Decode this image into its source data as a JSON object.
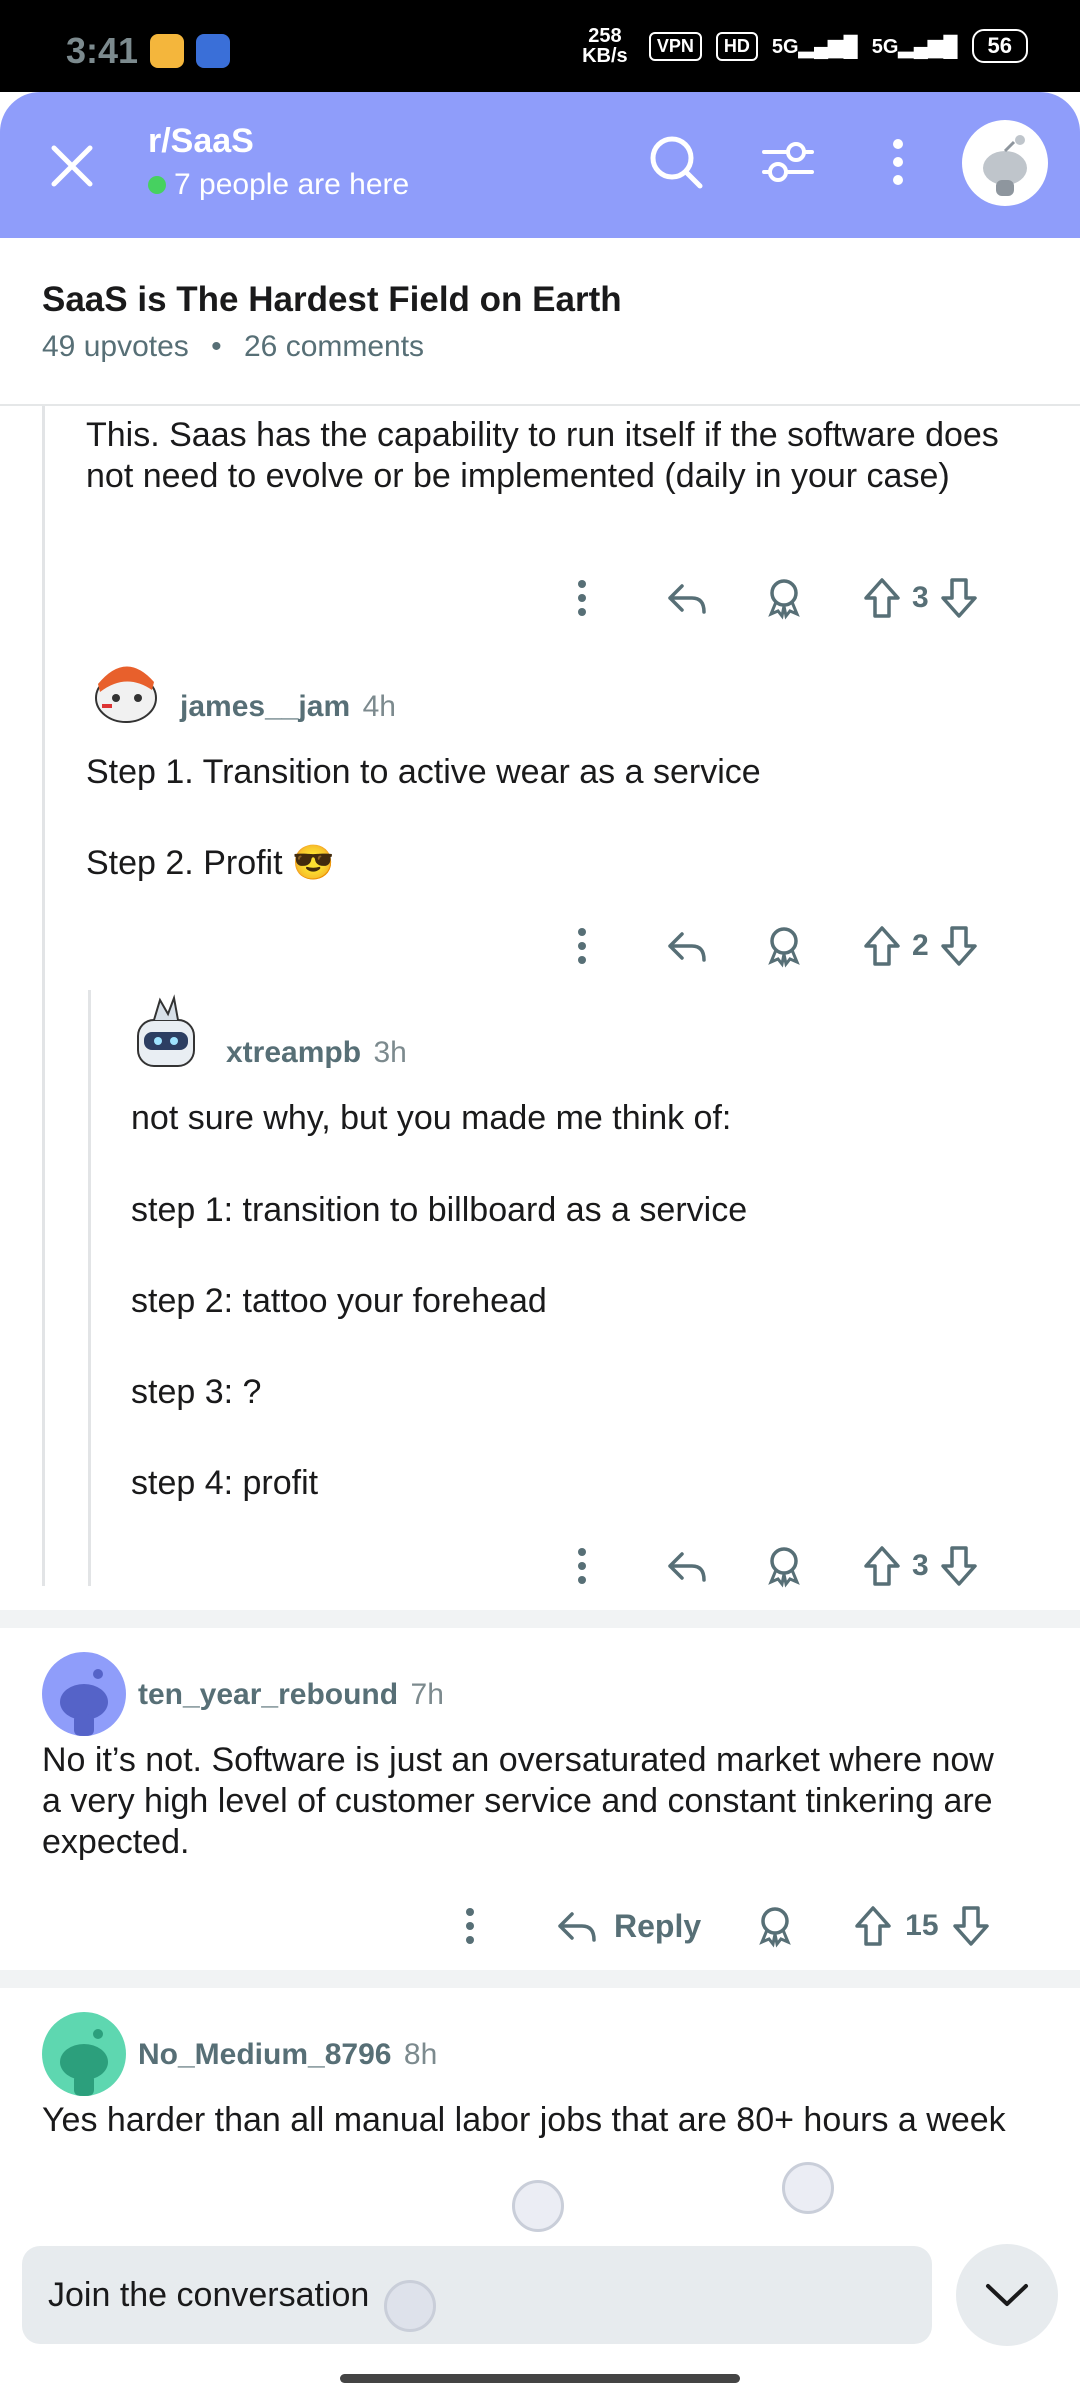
{
  "status_bar": {
    "time": "3:41",
    "speed": "258 KB/s",
    "vpn": "VPN",
    "hd": "HD",
    "net1": "5G",
    "net2": "5G",
    "battery": "56"
  },
  "header": {
    "subreddit": "r/SaaS",
    "online": "7 people are here",
    "accent": "#8f9dfa"
  },
  "post": {
    "title": "SaaS is The Hardest Field on Earth",
    "upvotes": "49 upvotes",
    "comments": "26 comments"
  },
  "comments": [
    {
      "body": "This. Saas has the capability to run itself if the software does not need to evolve or be implemented (daily in your case)",
      "score": "3"
    },
    {
      "user": "james__jam",
      "time": "4h",
      "lines": [
        "Step 1. Transition to active wear as a service",
        "Step 2. Profit 😎"
      ],
      "score": "2"
    },
    {
      "user": "xtreampb",
      "time": "3h",
      "lines": [
        "not sure why, but you made me think of:",
        "step 1: transition to billboard as a service",
        "step 2: tattoo your forehead",
        "step 3: ?",
        "step 4: profit"
      ],
      "score": "3"
    },
    {
      "user": "ten_year_rebound",
      "time": "7h",
      "body": "No it’s not. Software is just an oversaturated market where now a very high level of customer service and constant tinkering are expected.",
      "reply_label": "Reply",
      "score": "15"
    },
    {
      "user": "No_Medium_8796",
      "time": "8h",
      "body": "Yes harder than all manual labor jobs that are 80+ hours a week"
    }
  ],
  "composer": {
    "placeholder": "Join the conversation"
  }
}
